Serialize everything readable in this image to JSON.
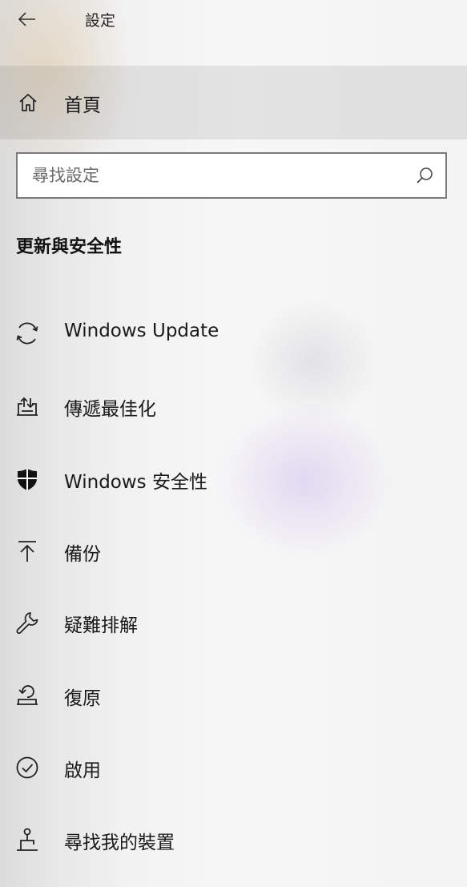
{
  "header": {
    "title": "設定",
    "back_icon": "back-arrow-icon"
  },
  "home": {
    "label": "首頁",
    "icon": "home-icon"
  },
  "search": {
    "placeholder": "尋找設定",
    "value": "",
    "icon": "search-icon"
  },
  "section": {
    "heading": "更新與安全性"
  },
  "nav": {
    "items": [
      {
        "label": "Windows Update",
        "icon": "sync-icon"
      },
      {
        "label": "傳遞最佳化",
        "icon": "delivery-optimization-icon"
      },
      {
        "label": "Windows 安全性",
        "icon": "shield-icon"
      },
      {
        "label": "備份",
        "icon": "backup-upload-icon"
      },
      {
        "label": "疑難排解",
        "icon": "wrench-icon"
      },
      {
        "label": "復原",
        "icon": "recovery-icon"
      },
      {
        "label": "啟用",
        "icon": "check-circle-icon"
      },
      {
        "label": "尋找我的裝置",
        "icon": "find-device-icon"
      }
    ]
  }
}
